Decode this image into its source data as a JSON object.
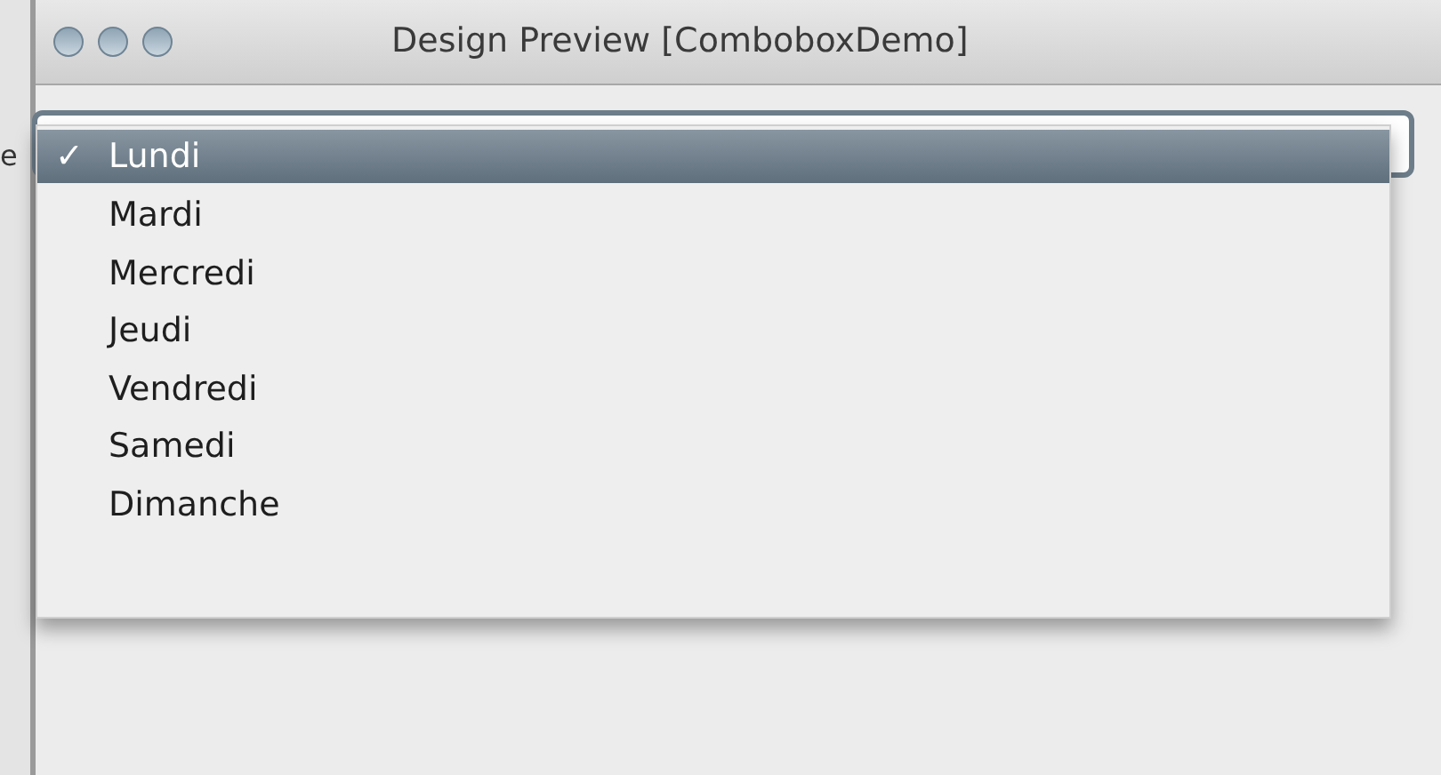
{
  "window": {
    "title": "Design Preview [ComboboxDemo]"
  },
  "background_label": "e",
  "menu": {
    "check_mark": "✓",
    "items": [
      {
        "label": "Lundi",
        "selected": true
      },
      {
        "label": "Mardi",
        "selected": false
      },
      {
        "label": "Mercredi",
        "selected": false
      },
      {
        "label": "Jeudi",
        "selected": false
      },
      {
        "label": "Vendredi",
        "selected": false
      },
      {
        "label": "Samedi",
        "selected": false
      },
      {
        "label": "Dimanche",
        "selected": false
      }
    ]
  }
}
